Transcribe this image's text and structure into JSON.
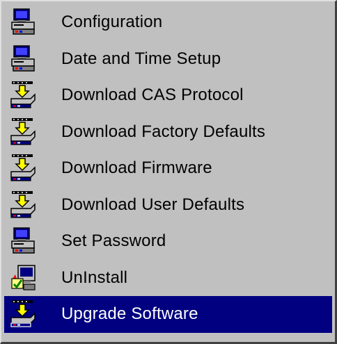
{
  "menu": {
    "items": [
      {
        "label": "Configuration",
        "icon": "computer-icon",
        "selected": false
      },
      {
        "label": "Date and Time Setup",
        "icon": "computer-icon",
        "selected": false
      },
      {
        "label": "Download CAS Protocol",
        "icon": "download-disk-icon",
        "selected": false
      },
      {
        "label": "Download Factory Defaults",
        "icon": "download-disk-icon",
        "selected": false
      },
      {
        "label": "Download Firmware",
        "icon": "download-disk-icon",
        "selected": false
      },
      {
        "label": "Download User Defaults",
        "icon": "download-disk-icon",
        "selected": false
      },
      {
        "label": "Set Password",
        "icon": "computer-icon",
        "selected": false
      },
      {
        "label": "UnInstall",
        "icon": "uninstall-icon",
        "selected": false
      },
      {
        "label": "Upgrade Software",
        "icon": "download-disk-icon",
        "selected": true
      }
    ]
  },
  "colors": {
    "menu_background": "#c0c0c0",
    "selection_background": "#000080",
    "selection_text": "#ffffff",
    "text": "#000000"
  }
}
